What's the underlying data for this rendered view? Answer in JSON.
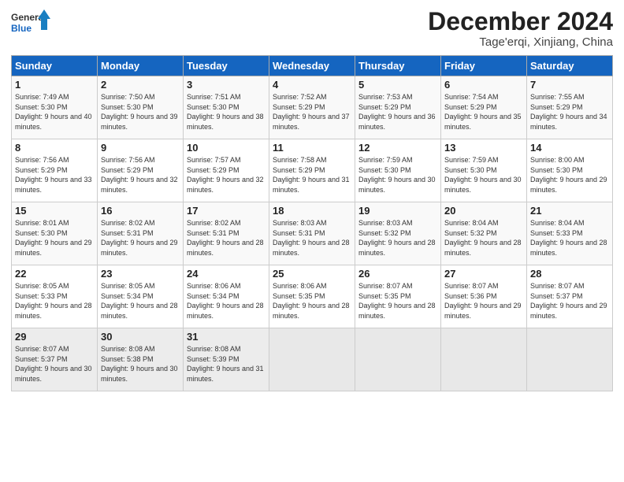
{
  "header": {
    "logo_general": "General",
    "logo_blue": "Blue",
    "title": "December 2024",
    "subtitle": "Tage'erqi, Xinjiang, China"
  },
  "days_of_week": [
    "Sunday",
    "Monday",
    "Tuesday",
    "Wednesday",
    "Thursday",
    "Friday",
    "Saturday"
  ],
  "weeks": [
    [
      {
        "day": "1",
        "sunrise": "Sunrise: 7:49 AM",
        "sunset": "Sunset: 5:30 PM",
        "daylight": "Daylight: 9 hours and 40 minutes."
      },
      {
        "day": "2",
        "sunrise": "Sunrise: 7:50 AM",
        "sunset": "Sunset: 5:30 PM",
        "daylight": "Daylight: 9 hours and 39 minutes."
      },
      {
        "day": "3",
        "sunrise": "Sunrise: 7:51 AM",
        "sunset": "Sunset: 5:30 PM",
        "daylight": "Daylight: 9 hours and 38 minutes."
      },
      {
        "day": "4",
        "sunrise": "Sunrise: 7:52 AM",
        "sunset": "Sunset: 5:29 PM",
        "daylight": "Daylight: 9 hours and 37 minutes."
      },
      {
        "day": "5",
        "sunrise": "Sunrise: 7:53 AM",
        "sunset": "Sunset: 5:29 PM",
        "daylight": "Daylight: 9 hours and 36 minutes."
      },
      {
        "day": "6",
        "sunrise": "Sunrise: 7:54 AM",
        "sunset": "Sunset: 5:29 PM",
        "daylight": "Daylight: 9 hours and 35 minutes."
      },
      {
        "day": "7",
        "sunrise": "Sunrise: 7:55 AM",
        "sunset": "Sunset: 5:29 PM",
        "daylight": "Daylight: 9 hours and 34 minutes."
      }
    ],
    [
      {
        "day": "8",
        "sunrise": "Sunrise: 7:56 AM",
        "sunset": "Sunset: 5:29 PM",
        "daylight": "Daylight: 9 hours and 33 minutes."
      },
      {
        "day": "9",
        "sunrise": "Sunrise: 7:56 AM",
        "sunset": "Sunset: 5:29 PM",
        "daylight": "Daylight: 9 hours and 32 minutes."
      },
      {
        "day": "10",
        "sunrise": "Sunrise: 7:57 AM",
        "sunset": "Sunset: 5:29 PM",
        "daylight": "Daylight: 9 hours and 32 minutes."
      },
      {
        "day": "11",
        "sunrise": "Sunrise: 7:58 AM",
        "sunset": "Sunset: 5:29 PM",
        "daylight": "Daylight: 9 hours and 31 minutes."
      },
      {
        "day": "12",
        "sunrise": "Sunrise: 7:59 AM",
        "sunset": "Sunset: 5:30 PM",
        "daylight": "Daylight: 9 hours and 30 minutes."
      },
      {
        "day": "13",
        "sunrise": "Sunrise: 7:59 AM",
        "sunset": "Sunset: 5:30 PM",
        "daylight": "Daylight: 9 hours and 30 minutes."
      },
      {
        "day": "14",
        "sunrise": "Sunrise: 8:00 AM",
        "sunset": "Sunset: 5:30 PM",
        "daylight": "Daylight: 9 hours and 29 minutes."
      }
    ],
    [
      {
        "day": "15",
        "sunrise": "Sunrise: 8:01 AM",
        "sunset": "Sunset: 5:30 PM",
        "daylight": "Daylight: 9 hours and 29 minutes."
      },
      {
        "day": "16",
        "sunrise": "Sunrise: 8:02 AM",
        "sunset": "Sunset: 5:31 PM",
        "daylight": "Daylight: 9 hours and 29 minutes."
      },
      {
        "day": "17",
        "sunrise": "Sunrise: 8:02 AM",
        "sunset": "Sunset: 5:31 PM",
        "daylight": "Daylight: 9 hours and 28 minutes."
      },
      {
        "day": "18",
        "sunrise": "Sunrise: 8:03 AM",
        "sunset": "Sunset: 5:31 PM",
        "daylight": "Daylight: 9 hours and 28 minutes."
      },
      {
        "day": "19",
        "sunrise": "Sunrise: 8:03 AM",
        "sunset": "Sunset: 5:32 PM",
        "daylight": "Daylight: 9 hours and 28 minutes."
      },
      {
        "day": "20",
        "sunrise": "Sunrise: 8:04 AM",
        "sunset": "Sunset: 5:32 PM",
        "daylight": "Daylight: 9 hours and 28 minutes."
      },
      {
        "day": "21",
        "sunrise": "Sunrise: 8:04 AM",
        "sunset": "Sunset: 5:33 PM",
        "daylight": "Daylight: 9 hours and 28 minutes."
      }
    ],
    [
      {
        "day": "22",
        "sunrise": "Sunrise: 8:05 AM",
        "sunset": "Sunset: 5:33 PM",
        "daylight": "Daylight: 9 hours and 28 minutes."
      },
      {
        "day": "23",
        "sunrise": "Sunrise: 8:05 AM",
        "sunset": "Sunset: 5:34 PM",
        "daylight": "Daylight: 9 hours and 28 minutes."
      },
      {
        "day": "24",
        "sunrise": "Sunrise: 8:06 AM",
        "sunset": "Sunset: 5:34 PM",
        "daylight": "Daylight: 9 hours and 28 minutes."
      },
      {
        "day": "25",
        "sunrise": "Sunrise: 8:06 AM",
        "sunset": "Sunset: 5:35 PM",
        "daylight": "Daylight: 9 hours and 28 minutes."
      },
      {
        "day": "26",
        "sunrise": "Sunrise: 8:07 AM",
        "sunset": "Sunset: 5:35 PM",
        "daylight": "Daylight: 9 hours and 28 minutes."
      },
      {
        "day": "27",
        "sunrise": "Sunrise: 8:07 AM",
        "sunset": "Sunset: 5:36 PM",
        "daylight": "Daylight: 9 hours and 29 minutes."
      },
      {
        "day": "28",
        "sunrise": "Sunrise: 8:07 AM",
        "sunset": "Sunset: 5:37 PM",
        "daylight": "Daylight: 9 hours and 29 minutes."
      }
    ],
    [
      {
        "day": "29",
        "sunrise": "Sunrise: 8:07 AM",
        "sunset": "Sunset: 5:37 PM",
        "daylight": "Daylight: 9 hours and 30 minutes."
      },
      {
        "day": "30",
        "sunrise": "Sunrise: 8:08 AM",
        "sunset": "Sunset: 5:38 PM",
        "daylight": "Daylight: 9 hours and 30 minutes."
      },
      {
        "day": "31",
        "sunrise": "Sunrise: 8:08 AM",
        "sunset": "Sunset: 5:39 PM",
        "daylight": "Daylight: 9 hours and 31 minutes."
      },
      null,
      null,
      null,
      null
    ]
  ]
}
